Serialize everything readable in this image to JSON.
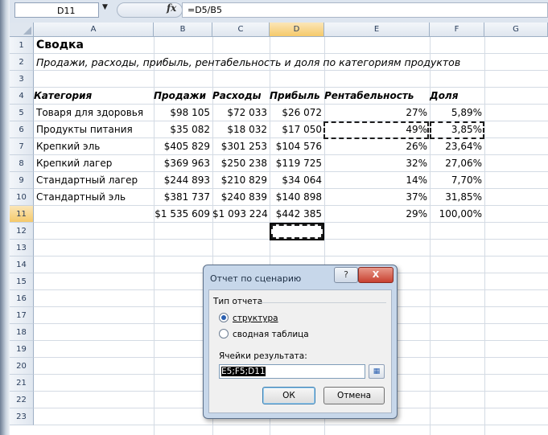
{
  "formula_bar": {
    "name_box": "D11",
    "formula": "=D5/B5"
  },
  "columns": [
    "A",
    "B",
    "C",
    "D",
    "E",
    "F",
    "G"
  ],
  "rows": [
    "1",
    "2",
    "3",
    "4",
    "5",
    "6",
    "7",
    "8",
    "9",
    "10",
    "11",
    "12",
    "13",
    "14",
    "15",
    "16",
    "17",
    "18",
    "19",
    "20",
    "21",
    "22",
    "23"
  ],
  "sheet": {
    "title": "Сводка",
    "subtitle": "Продажи, расходы, прибыль, рентабельность и доля по категориям продуктов",
    "headers": [
      "Категория",
      "Продажи",
      "Расходы",
      "Прибыль",
      "Рентабельность",
      "Доля"
    ],
    "data": [
      [
        "Товаря для здоровья",
        "$98 105",
        "$72 033",
        "$26 072",
        "27%",
        "5,89%"
      ],
      [
        "Продукты питания",
        "$35 082",
        "$18 032",
        "$17 050",
        "49%",
        "3,85%"
      ],
      [
        "Крепкий эль",
        "$405 829",
        "$301 253",
        "$104 576",
        "26%",
        "23,64%"
      ],
      [
        "Крепкий лагер",
        "$369 963",
        "$250 238",
        "$119 725",
        "32%",
        "27,06%"
      ],
      [
        "Стандартный лагер",
        "$244 893",
        "$210 829",
        "$34 064",
        "14%",
        "7,70%"
      ],
      [
        "Стандартный эль",
        "$381 737",
        "$240 839",
        "$140 898",
        "37%",
        "31,85%"
      ]
    ],
    "total": [
      "",
      "$1 535 609",
      "$1 093 224",
      "$442 385",
      "29%",
      "100,00%"
    ]
  },
  "dialog": {
    "title": "Отчет по сценарию",
    "help": "?",
    "close": "X",
    "group_label": "Тип отчета",
    "option1": "структура",
    "option2": "сводная таблица",
    "selected_option": "структура",
    "field_label": "Ячейки результата:",
    "field_value": "E5;F5;D11",
    "ok": "ОК",
    "cancel": "Отмена"
  }
}
